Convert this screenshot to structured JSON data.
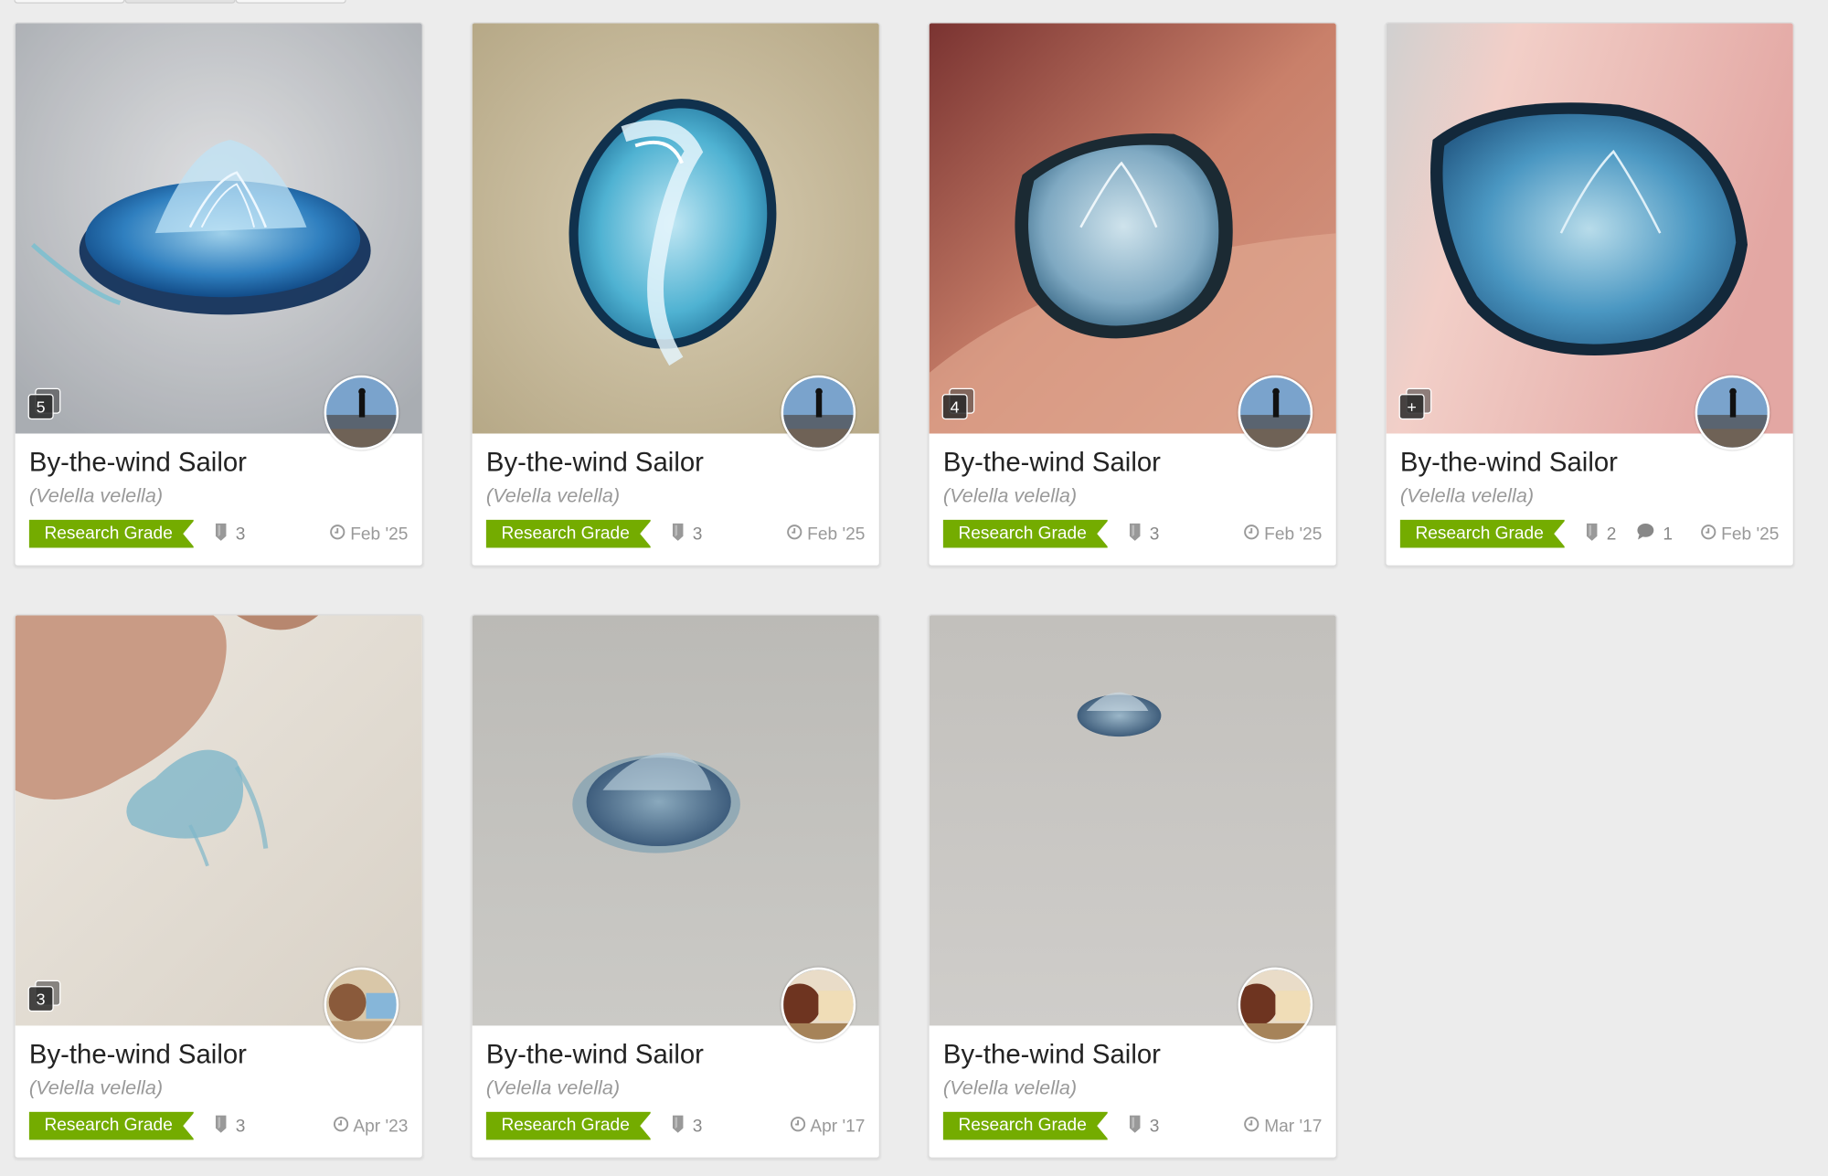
{
  "observations": [
    {
      "common_name": "By-the-wind Sailor",
      "scientific_name": "(Velella velella)",
      "quality": "Research Grade",
      "photo_count": "5",
      "ids": "3",
      "comments": "",
      "date": "Feb '25",
      "scene": "sand-blue"
    },
    {
      "common_name": "By-the-wind Sailor",
      "scientific_name": "(Velella velella)",
      "quality": "Research Grade",
      "photo_count": "",
      "ids": "3",
      "comments": "",
      "date": "Feb '25",
      "scene": "sand-oval"
    },
    {
      "common_name": "By-the-wind Sailor",
      "scientific_name": "(Velella velella)",
      "quality": "Research Grade",
      "photo_count": "4",
      "ids": "3",
      "comments": "",
      "date": "Feb '25",
      "scene": "finger-1"
    },
    {
      "common_name": "By-the-wind Sailor",
      "scientific_name": "(Velella velella)",
      "quality": "Research Grade",
      "photo_count": "+",
      "ids": "2",
      "comments": "1",
      "date": "Feb '25",
      "scene": "finger-2"
    },
    {
      "common_name": "By-the-wind Sailor",
      "scientific_name": "(Velella velella)",
      "quality": "Research Grade",
      "photo_count": "3",
      "ids": "3",
      "comments": "",
      "date": "Apr '23",
      "scene": "held"
    },
    {
      "common_name": "By-the-wind Sailor",
      "scientific_name": "(Velella velella)",
      "quality": "Research Grade",
      "photo_count": "",
      "ids": "3",
      "comments": "",
      "date": "Apr '17",
      "scene": "beach-1"
    },
    {
      "common_name": "By-the-wind Sailor",
      "scientific_name": "(Velella velella)",
      "quality": "Research Grade",
      "photo_count": "",
      "ids": "3",
      "comments": "",
      "date": "Mar '17",
      "scene": "beach-2"
    }
  ],
  "colors": {
    "research_grade": "#74ac00",
    "background": "#ececec"
  }
}
